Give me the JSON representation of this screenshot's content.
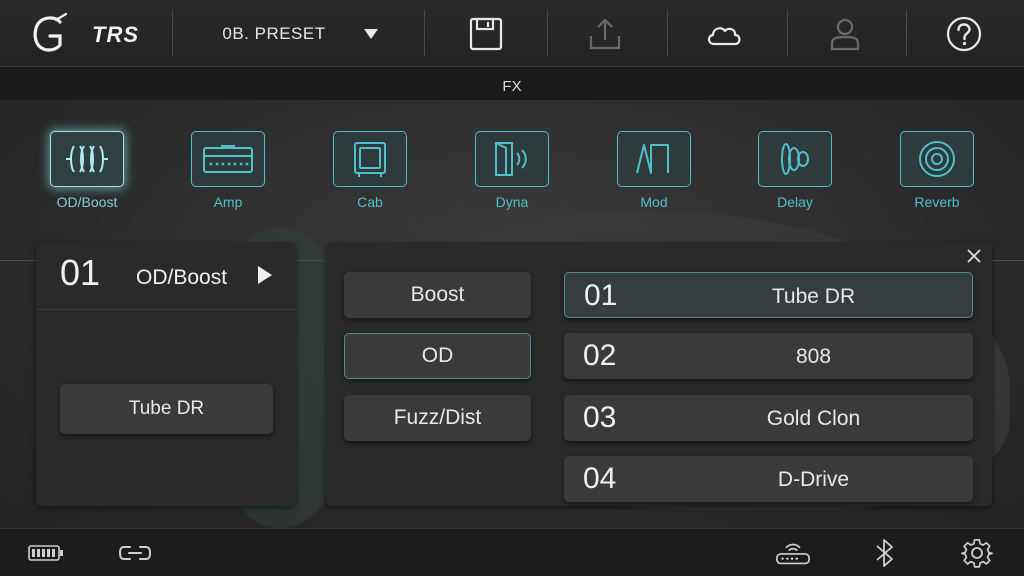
{
  "app": {
    "logo_text": "TRS",
    "logo_mark": "G"
  },
  "header": {
    "preset_label": "0B. PRESET",
    "icons": [
      "dropdown-caret-icon",
      "save-icon",
      "upload-icon",
      "cloud-icon",
      "user-icon",
      "help-icon"
    ]
  },
  "section": {
    "title": "FX"
  },
  "fx_chain": [
    {
      "label": "OD/Boost",
      "icon": "od-boost-icon",
      "active": true
    },
    {
      "label": "Amp",
      "icon": "amp-icon",
      "active": false
    },
    {
      "label": "Cab",
      "icon": "cab-icon",
      "active": false
    },
    {
      "label": "Dyna",
      "icon": "dyna-icon",
      "active": false
    },
    {
      "label": "Mod",
      "icon": "mod-icon",
      "active": false
    },
    {
      "label": "Delay",
      "icon": "delay-icon",
      "active": false
    },
    {
      "label": "Reverb",
      "icon": "reverb-icon",
      "active": false
    }
  ],
  "left_panel": {
    "number": "01",
    "title": "OD/Boost",
    "model_button": "Tube DR"
  },
  "categories": [
    {
      "label": "Boost",
      "selected": false
    },
    {
      "label": "OD",
      "selected": true
    },
    {
      "label": "Fuzz/Dist",
      "selected": false
    }
  ],
  "models": [
    {
      "number": "01",
      "name": "Tube DR",
      "selected": true
    },
    {
      "number": "02",
      "name": "808",
      "selected": false
    },
    {
      "number": "03",
      "name": "Gold Clon",
      "selected": false
    },
    {
      "number": "04",
      "name": "D-Drive",
      "selected": false
    }
  ],
  "footer": {
    "icons": [
      "battery-icon",
      "link-icon",
      "router-icon",
      "bluetooth-icon",
      "settings-icon"
    ]
  },
  "colors": {
    "accent": "#4fc0cc",
    "selected_border": "#4e8c96",
    "panel": "#2a2a2a",
    "button": "#3a3a3a"
  }
}
